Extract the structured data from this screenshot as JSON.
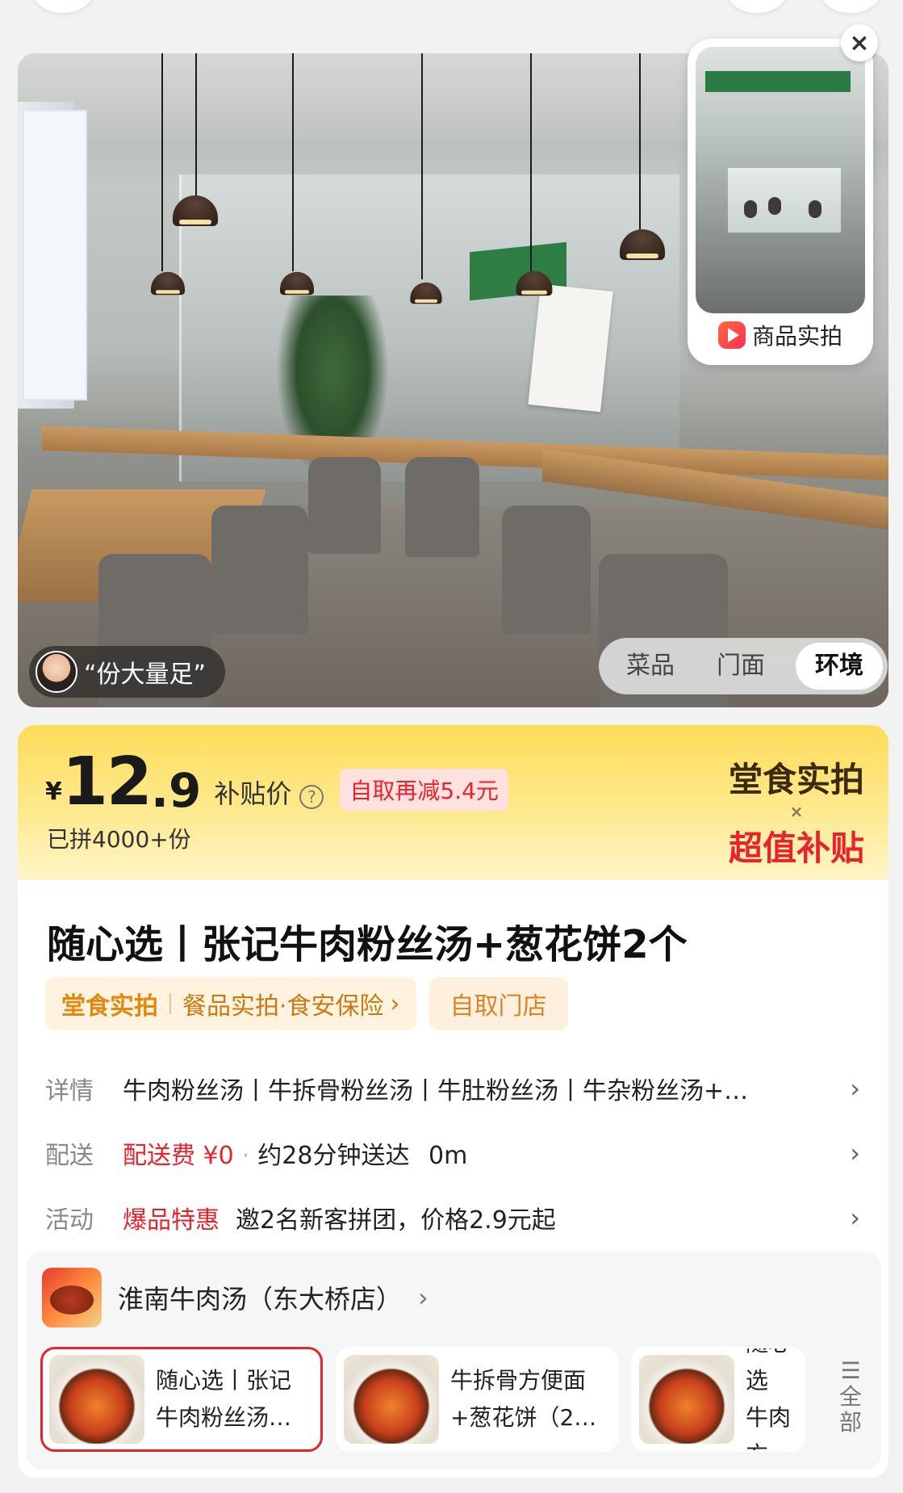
{
  "hero": {
    "live_label": "商品实拍",
    "close_glyph": "×",
    "quote": "“份大量足”",
    "view_tabs": [
      {
        "label": "菜品",
        "active": false
      },
      {
        "label": "门面",
        "active": false
      },
      {
        "label": "环境",
        "active": true
      }
    ]
  },
  "price": {
    "currency": "¥",
    "int": "12",
    "dec": ".9",
    "label": "补贴价",
    "help_glyph": "?",
    "coupon": "自取再减5.4元",
    "sold": "已拼4000+份",
    "promo_top": "堂食实拍",
    "promo_mid": "×",
    "promo_bottom": "超值补贴"
  },
  "product": {
    "title": "随心选丨张记牛肉粉丝汤+葱花饼2个",
    "tag_main": "堂食实拍",
    "tag_sub": "餐品实拍·食安保险",
    "tag_arrow": "›",
    "tag_pickup": "自取门店"
  },
  "rows": {
    "detail_key": "详情",
    "detail_val": "牛肉粉丝汤丨牛拆骨粉丝汤丨牛肚粉丝汤丨牛杂粉丝汤+…",
    "delivery_key": "配送",
    "delivery_fee": "配送费 ¥0",
    "delivery_sep": "·",
    "delivery_time": "约28分钟送达",
    "delivery_dist": "0m",
    "activity_key": "活动",
    "activity_tag": "爆品特惠",
    "activity_val": "邀2名新客拼团，价格2.9元起",
    "chevron": "›"
  },
  "store": {
    "name": "淮南牛肉汤（东大桥店）",
    "arrow": "›",
    "items": [
      {
        "line1": "随心选丨张记",
        "line2": "牛肉粉丝汤…"
      },
      {
        "line1": "牛拆骨方便面",
        "line2": "+葱花饼（2…"
      },
      {
        "line1": "随心选",
        "line2": "牛肉方"
      }
    ],
    "all_label": "全部",
    "all_glyph": "☰"
  }
}
